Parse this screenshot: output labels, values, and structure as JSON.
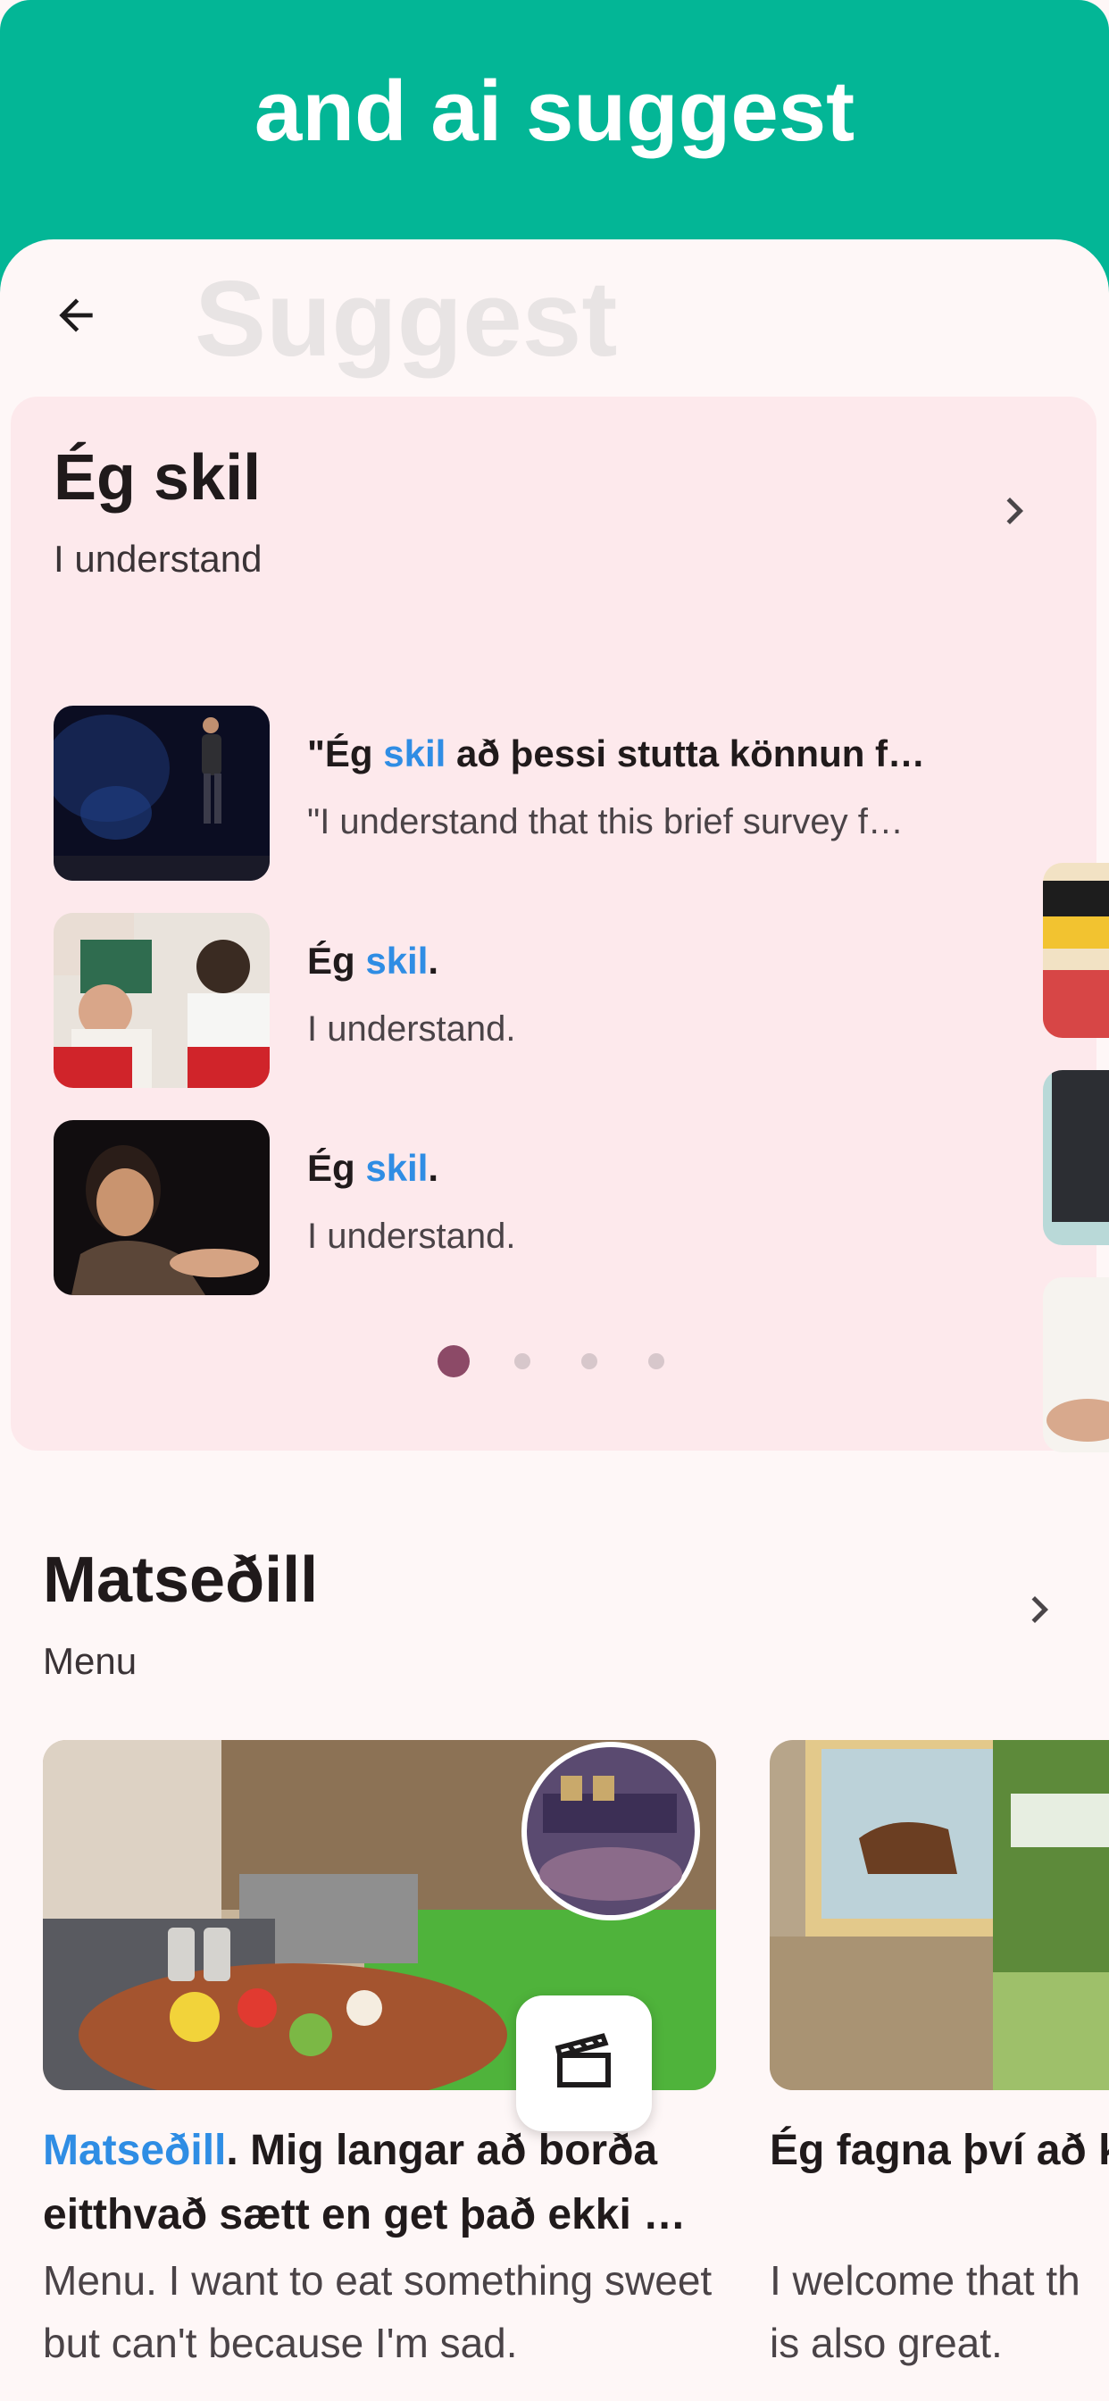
{
  "banner": {
    "title": "and ai suggest"
  },
  "header": {
    "ghost_title": "Suggest"
  },
  "card": {
    "title": "Ég skil",
    "subtitle": "I understand",
    "rows": [
      {
        "pre": "\"Ég ",
        "hl": "skil",
        "post": " að þessi stutta könnun f…",
        "translation": "\"I understand that this brief survey f…"
      },
      {
        "pre": "Ég ",
        "hl": "skil",
        "post": ".",
        "translation": "I understand."
      },
      {
        "pre": "Ég ",
        "hl": "skil",
        "post": ".",
        "translation": "I understand."
      }
    ],
    "pagination": {
      "count": 4,
      "active": 0
    }
  },
  "menu_section": {
    "title": "Matseðill",
    "subtitle": "Menu",
    "cards": [
      {
        "hl": "Matseðill",
        "title_rest": ". Mig langar að borða eitthvað sætt en get það ekki …",
        "translation": "Menu. I want to eat something sweet but can't because I'm sad."
      },
      {
        "title": "Ég fagna því að kaffihúsamatseð",
        "translation": "I welcome that th is also great."
      }
    ]
  },
  "icons": {
    "back": "arrow-left-icon",
    "chevron": "chevron-right-icon",
    "video": "clapperboard-icon"
  },
  "colors": {
    "banner": "#03b696",
    "card_bg": "#fde9ec",
    "highlight": "#2f8de4",
    "active_dot": "#8c4a67"
  }
}
